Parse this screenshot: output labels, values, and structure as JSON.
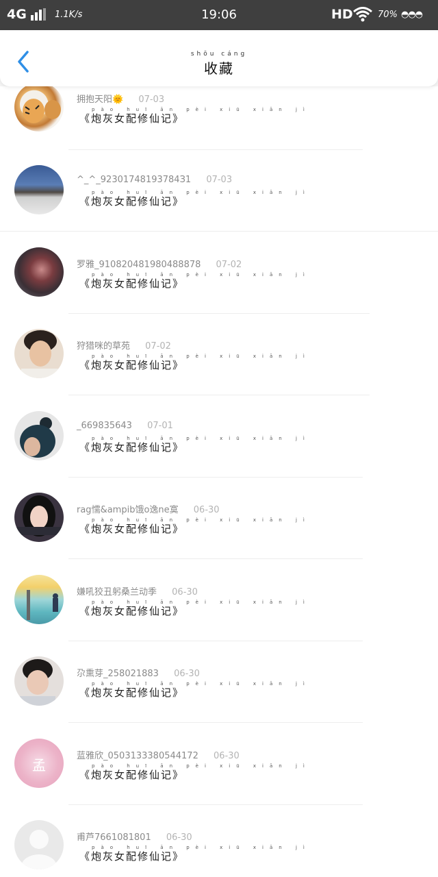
{
  "status_bar": {
    "network": "4G",
    "speed": "1.1K/s",
    "time": "19:06",
    "hd": "HD",
    "battery": "70%",
    "emoji": "◓◓◓"
  },
  "header": {
    "back_icon": "chevron-left-icon",
    "title_ruby": "shōu cáng",
    "title": "收藏",
    "accent": "#2f8fe6"
  },
  "book_ruby": "pào huī ān pèi xiū xiān jì",
  "items": [
    {
      "user": "拥抱天阳🌞",
      "date": "07-03",
      "book": "《炮灰女配修仙记》"
    },
    {
      "user": "^_^_92301748193784З1",
      "date": "07-03",
      "book": "《炮灰女配修仙记》"
    },
    {
      "user": "罗雅_910820481980488878",
      "date": "07-02",
      "book": "《炮灰女配修仙记》"
    },
    {
      "user": "狩猎咪的草苑",
      "date": "07-02",
      "book": "《炮灰女配修仙记》"
    },
    {
      "user": "_669835643",
      "date": "07-01",
      "book": "《炮灰女配修仙记》"
    },
    {
      "user": "rag懦&ampib饿o逸ne寞",
      "date": "06-30",
      "book": "《炮灰女配修仙记》"
    },
    {
      "user": "嫌吼狡丑躬桑兰动季",
      "date": "06-30",
      "book": "《炮灰女配修仙记》"
    },
    {
      "user": "尕熏芽_258021883",
      "date": "06-30",
      "book": "《炮灰女配修仙记》"
    },
    {
      "user": "蓝雅欣_0503133380544172",
      "date": "06-30",
      "book": "《炮灰女配修仙记》"
    },
    {
      "user": "甫芦7661081801",
      "date": "06-30",
      "book": "《炮灰女配修仙记》"
    }
  ]
}
